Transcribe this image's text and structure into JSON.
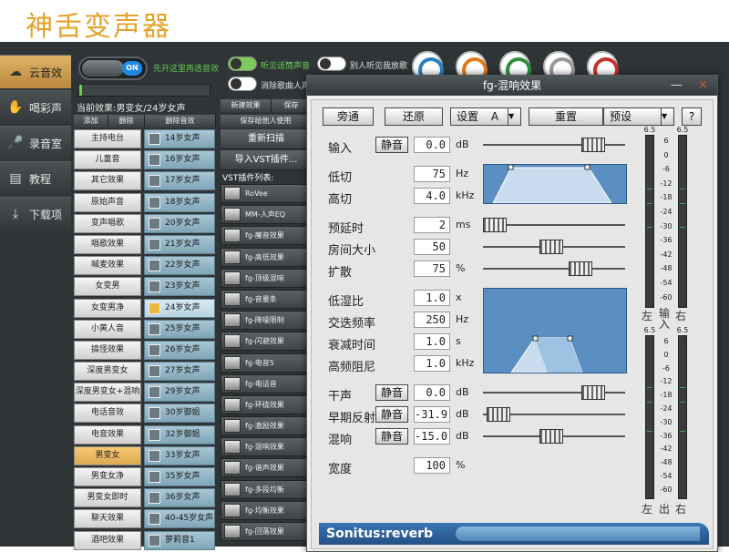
{
  "slide_title": "神舌变声器",
  "nav": [
    {
      "label": "云音效",
      "icon": "cloud-icon"
    },
    {
      "label": "喝彩声",
      "icon": "applause-icon"
    },
    {
      "label": "录音室",
      "icon": "microphone-icon"
    },
    {
      "label": "教程",
      "icon": "book-icon"
    },
    {
      "label": "下载项",
      "icon": "download-icon"
    }
  ],
  "top": {
    "toggle_on": "ON",
    "hint": "先开这里再选音效",
    "switch1": "听见话筒声音",
    "switch2": "别人听见我放歌",
    "switch3": "消除歌曲人声",
    "dial_colors": [
      "#2a7fc0",
      "#e07a1f",
      "#2f8f3c",
      "#999999",
      "#c9302c"
    ],
    "progress_fraction": 0.02
  },
  "current_effect": "当前效果:男变女/24岁女声",
  "effect_buttons": [
    "添加",
    "删除",
    "删除音效"
  ],
  "effects": [
    "主持电台",
    "儿童音",
    "其它效果",
    "原始声音",
    "变声唱歌",
    "唱歌效果",
    "喊麦效果",
    "女变男",
    "女变男净",
    "小黄人音",
    "搞怪效果",
    "深度男变女",
    "深度男变女+混响",
    "电话音效",
    "电音效果",
    "男变女",
    "男变女净",
    "男变女即时",
    "聊天效果",
    "酒吧效果"
  ],
  "active_effect_index": 15,
  "presets": [
    "14岁女声",
    "16岁女声",
    "17岁女声",
    "18岁女声",
    "20岁女声",
    "21岁女声",
    "22岁女声",
    "23岁女声",
    "24岁女声",
    "25岁女声",
    "26岁女声",
    "27岁女声",
    "29岁女声",
    "30岁御姐",
    "32岁御姐",
    "33岁女声",
    "35岁女声",
    "36岁女声",
    "40-45岁女声",
    "萝莉音1"
  ],
  "active_preset_index": 8,
  "vst": {
    "tab1": "新建效果",
    "tab2": "保存",
    "save_hint": "保存给他人使用",
    "rescan": "重新扫描",
    "import": "导入VST插件...",
    "list_title": "VST插件列表:",
    "plugins": [
      "RoVee",
      "MM-人声EQ",
      "fg-魔音效果",
      "fg-高低效果",
      "fg-顶级混响",
      "fg-音量条",
      "fg-降噪限制",
      "fg-闪避效果",
      "fg-电音5",
      "fg-电话音",
      "fg-环绕效果",
      "fg-激励效果",
      "fg-混响效果",
      "fg-谐声效果",
      "fg-多段均衡",
      "fg-均衡效果",
      "fg-回落效果"
    ]
  },
  "dialog": {
    "title": "fg-混响效果",
    "min": "—",
    "close": "×",
    "toolbar": {
      "bypass": "旁通",
      "restore": "还原",
      "settings": "设置",
      "slot": "A",
      "reset": "重置",
      "preset": "预设",
      "help": "?"
    },
    "input": {
      "label": "输入",
      "mute": "静音",
      "value": "0.0",
      "unit": "dB"
    },
    "lowcut": {
      "label": "低切",
      "value": "75",
      "unit": "Hz"
    },
    "highcut": {
      "label": "高切",
      "value": "4.0",
      "unit": "kHz"
    },
    "predelay": {
      "label": "预延时",
      "value": "2",
      "unit": "ms"
    },
    "roomsize": {
      "label": "房间大小",
      "value": "50"
    },
    "diffusion": {
      "label": "扩散",
      "value": "75",
      "unit": "%"
    },
    "lowratio": {
      "label": "低湿比",
      "value": "1.0",
      "unit": "x"
    },
    "crossover": {
      "label": "交迭频率",
      "value": "250",
      "unit": "Hz"
    },
    "decay": {
      "label": "衰减时间",
      "value": "1.0",
      "unit": "s"
    },
    "hfdamp": {
      "label": "高频阻尼",
      "value": "1.0",
      "unit": "kHz"
    },
    "dry": {
      "label": "干声",
      "mute": "静音",
      "value": "0.0",
      "unit": "dB"
    },
    "early": {
      "label": "早期反射",
      "mute": "静音",
      "value": "-31.9",
      "unit": "dB"
    },
    "reverb": {
      "label": "混响",
      "mute": "静音",
      "value": "-15.0",
      "unit": "dB"
    },
    "width": {
      "label": "宽度",
      "value": "100",
      "unit": "%"
    },
    "meter_peak": "6.5",
    "meter_scale": [
      "6",
      "0",
      "-6",
      "-12",
      "-18",
      "-24",
      "-30",
      "-36",
      "-42",
      "-48",
      "-54",
      "-60"
    ],
    "meter_in": {
      "left": "左",
      "mid": "输入",
      "right": "右"
    },
    "meter_out": {
      "left": "左",
      "mid": "出",
      "right": "右"
    },
    "brand": "Sonitus:reverb"
  }
}
